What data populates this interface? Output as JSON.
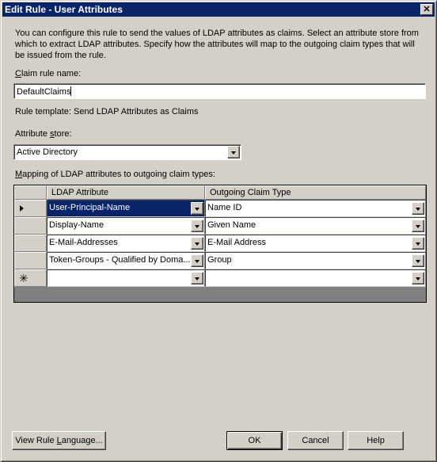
{
  "window": {
    "title": "Edit Rule - User Attributes",
    "close_label": "✕"
  },
  "description": "You can configure this rule to send the values of LDAP attributes as claims. Select an attribute store from which to extract LDAP attributes. Specify how the attributes will map to the outgoing claim types that will be issued from the rule.",
  "claim_rule_name": {
    "label_accel": "C",
    "label_rest": "laim rule name:",
    "value": "DefaultClaims"
  },
  "rule_template": "Rule template: Send LDAP Attributes as Claims",
  "attribute_store": {
    "label_pre": "Attribute ",
    "label_accel": "s",
    "label_rest": "tore:",
    "selected": "Active Directory"
  },
  "mapping": {
    "label_accel": "M",
    "label_rest": "apping of LDAP attributes to outgoing claim types:",
    "columns": [
      "LDAP Attribute",
      "Outgoing Claim Type"
    ],
    "rows": [
      {
        "ldap": "User-Principal-Name",
        "claim": "Name ID",
        "selected": true
      },
      {
        "ldap": "Display-Name",
        "claim": "Given Name"
      },
      {
        "ldap": "E-Mail-Addresses",
        "claim": "E-Mail Address"
      },
      {
        "ldap": "Token-Groups - Qualified by Doma...",
        "claim": "Group"
      },
      {
        "ldap": "",
        "claim": "",
        "new_row": true
      }
    ],
    "new_row_glyph": "✳"
  },
  "buttons": {
    "view_rule_pre": "View Rule ",
    "view_rule_accel": "L",
    "view_rule_rest": "anguage...",
    "ok": "OK",
    "cancel": "Cancel",
    "help": "Help"
  }
}
